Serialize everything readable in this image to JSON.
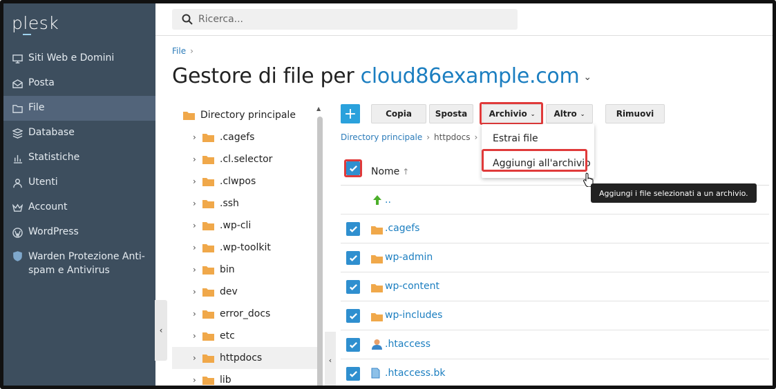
{
  "sidebar": {
    "logo": "plesk",
    "items": [
      {
        "label": "Siti Web e Domini",
        "icon": "monitor-icon"
      },
      {
        "label": "Posta",
        "icon": "mail-icon"
      },
      {
        "label": "File",
        "icon": "folder-icon"
      },
      {
        "label": "Database",
        "icon": "database-icon"
      },
      {
        "label": "Statistiche",
        "icon": "chart-icon"
      },
      {
        "label": "Utenti",
        "icon": "user-icon"
      },
      {
        "label": "Account",
        "icon": "crown-icon"
      },
      {
        "label": "WordPress",
        "icon": "wordpress-icon"
      },
      {
        "label": "Warden Protezione Anti-",
        "label2": "spam e Antivirus",
        "icon": "shield-icon"
      }
    ]
  },
  "search": {
    "placeholder": "Ricerca..."
  },
  "breadcrumb": {
    "item": "File",
    "sep": "›"
  },
  "title": {
    "prefix": "Gestore di file per",
    "domain": "cloud86example.com",
    "caret": "⌄"
  },
  "tree": {
    "root": "Directory principale",
    "items": [
      ".cagefs",
      ".cl.selector",
      ".clwpos",
      ".ssh",
      ".wp-cli",
      ".wp-toolkit",
      "bin",
      "dev",
      "error_docs",
      "etc",
      "httpdocs",
      "lib"
    ]
  },
  "toolbar": {
    "add": "+",
    "copy": "Copia",
    "move": "Sposta",
    "archive": "Archivio",
    "more": "Altro",
    "remove": "Rimuovi"
  },
  "path": {
    "root": "Directory principale",
    "current": "httpdocs",
    "sep": "›"
  },
  "dropdown": {
    "extract": "Estrai file",
    "add": "Aggiungi all'archivio"
  },
  "tooltip": "Aggiungi i file selezionati a un archivio.",
  "list": {
    "header": "Nome",
    "sort": "↑",
    "parent": "..",
    "rows": [
      {
        "name": ".cagefs",
        "type": "folder"
      },
      {
        "name": "wp-admin",
        "type": "folder"
      },
      {
        "name": "wp-content",
        "type": "folder"
      },
      {
        "name": "wp-includes",
        "type": "folder"
      },
      {
        "name": ".htaccess",
        "type": "user-file"
      },
      {
        "name": ".htaccess.bk",
        "type": "file"
      }
    ]
  },
  "colors": {
    "sidebar": "#3d4e5e",
    "accent": "#2aa1dc",
    "link": "#1b7ec0",
    "highlight": "#e03a3a",
    "folder": "#f0a84a"
  }
}
